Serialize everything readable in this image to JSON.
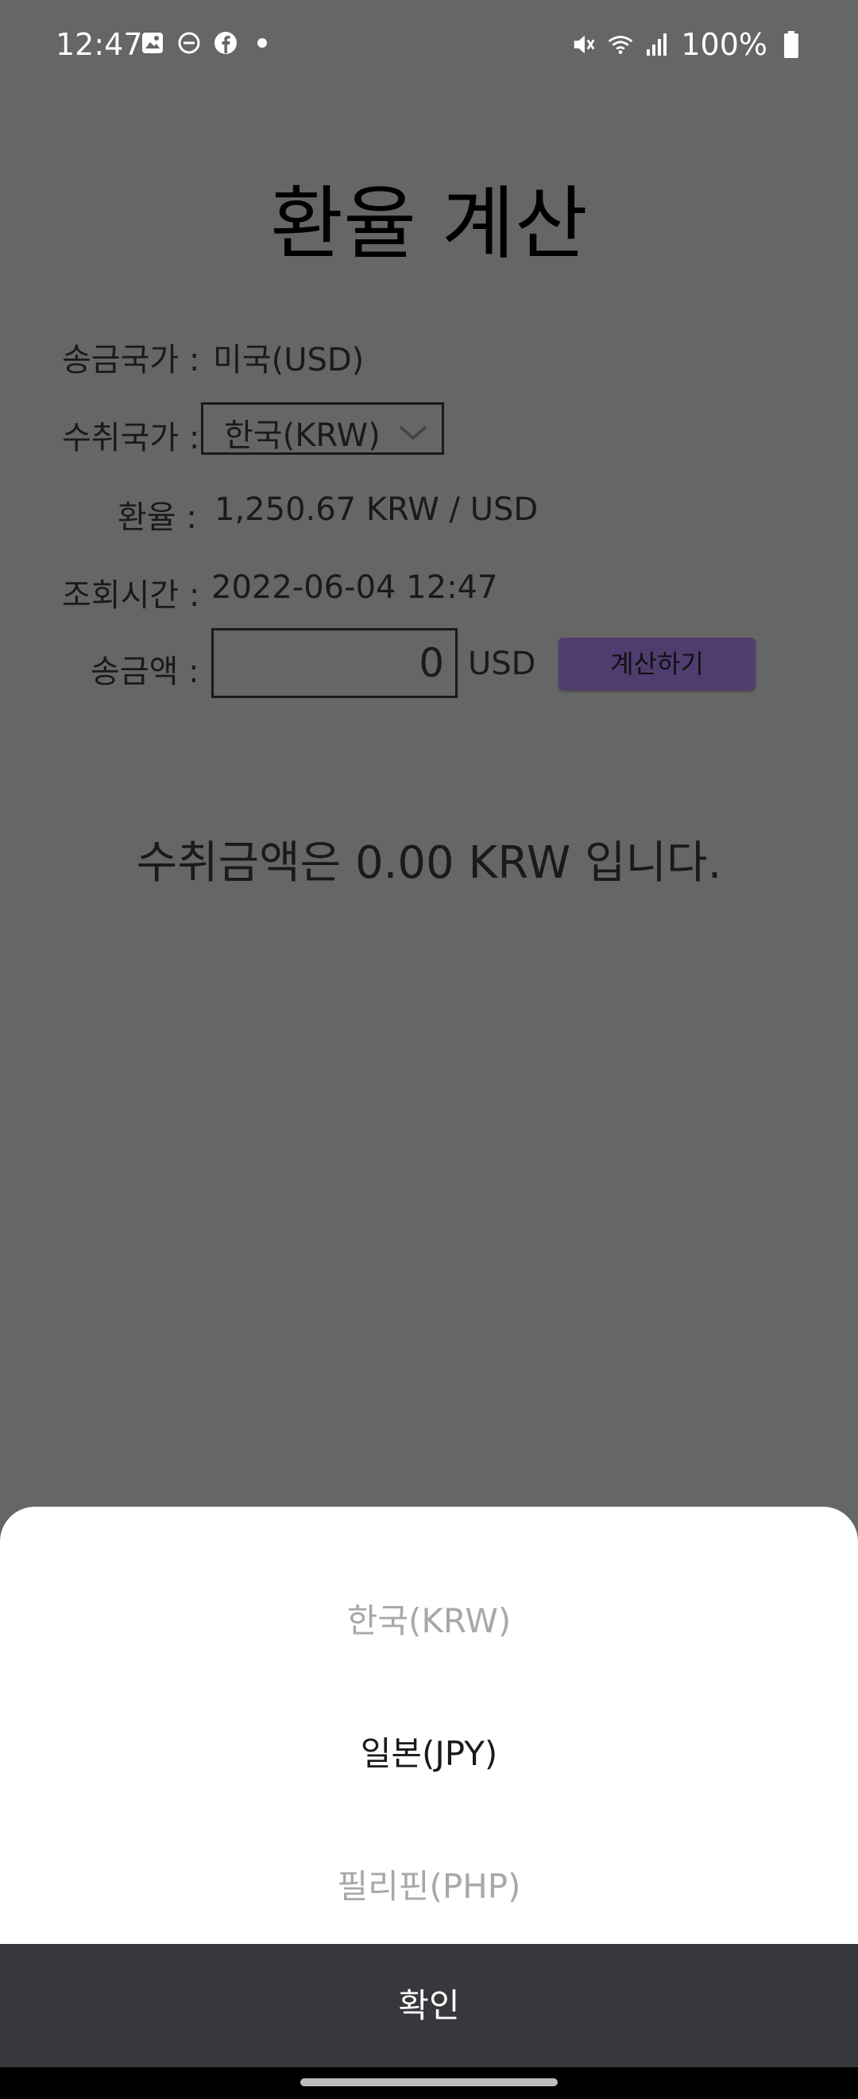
{
  "status_bar": {
    "time": "12:47",
    "battery": "100%",
    "icons_left": [
      "gallery-icon",
      "dnd-icon",
      "facebook-icon",
      "dot-icon"
    ],
    "icons_right": [
      "mute-icon",
      "wifi-icon",
      "signal-icon",
      "battery-icon"
    ]
  },
  "page": {
    "title": "환율 계산"
  },
  "form": {
    "send_country_label": "송금국가 :",
    "send_country_value": "미국(USD)",
    "receive_country_label": "수취국가 :",
    "receive_country_value": "한국(KRW)",
    "rate_label": "환율 :",
    "rate_value": "1,250.67 KRW / USD",
    "time_label": "조회시간 :",
    "time_value": "2022-06-04 12:47",
    "amount_label": "송금액 :",
    "amount_value": "0",
    "amount_unit": "USD",
    "calculate_button": "계산하기"
  },
  "result": {
    "text": "수취금액은 0.00 KRW 입니다."
  },
  "picker": {
    "options": [
      "한국(KRW)",
      "일본(JPY)",
      "필리핀(PHP)"
    ],
    "selected_index": 1,
    "confirm_label": "확인"
  },
  "colors": {
    "overlay": "#666666",
    "button": "#4f3d6f",
    "confirm_bar": "#38373c"
  }
}
